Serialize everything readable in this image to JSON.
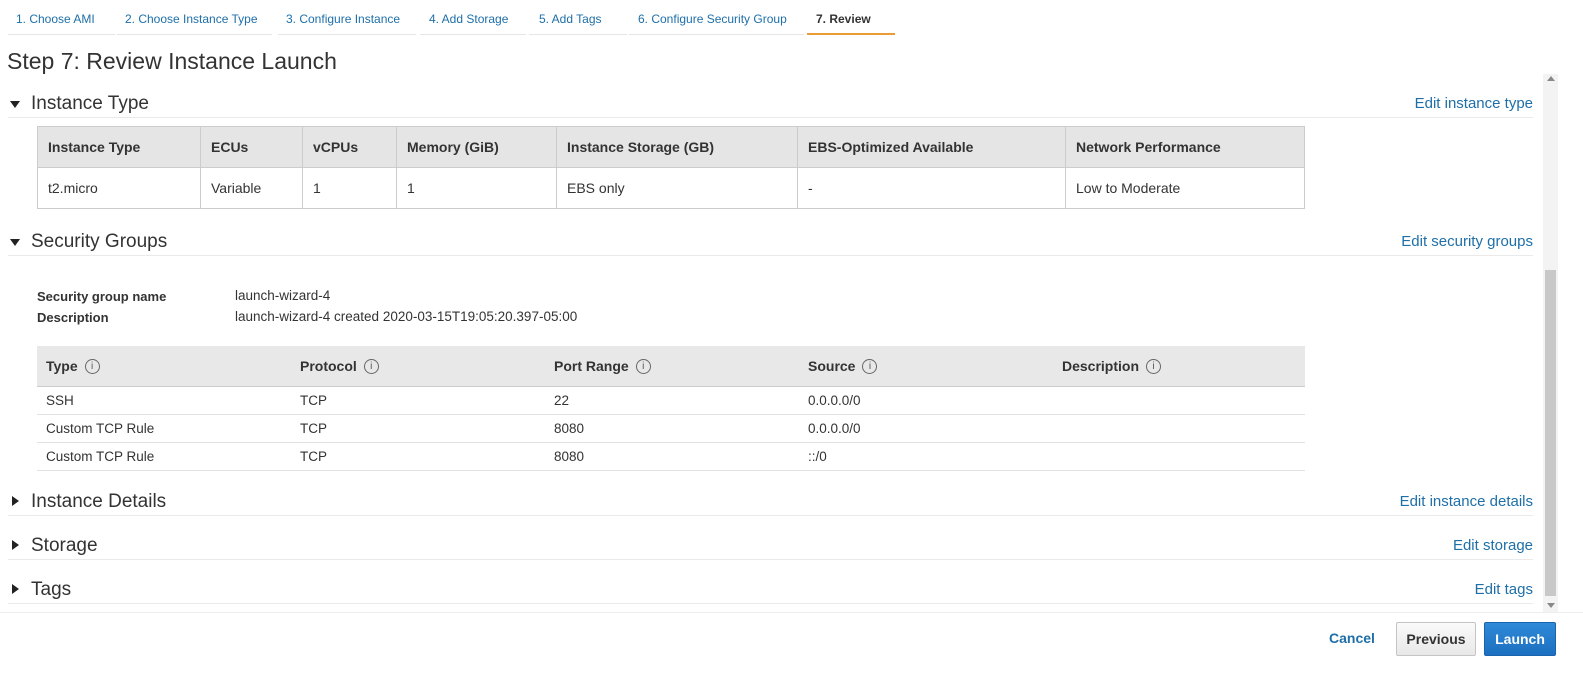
{
  "tabs": [
    {
      "label": "1. Choose AMI"
    },
    {
      "label": "2. Choose Instance Type"
    },
    {
      "label": "3. Configure Instance"
    },
    {
      "label": "4. Add Storage"
    },
    {
      "label": "5. Add Tags"
    },
    {
      "label": "6. Configure Security Group"
    },
    {
      "label": "7. Review",
      "active": true
    }
  ],
  "page_title": "Step 7: Review Instance Launch",
  "sections": {
    "instance_type": {
      "title": "Instance Type",
      "edit": "Edit instance type",
      "expanded": true
    },
    "security_groups": {
      "title": "Security Groups",
      "edit": "Edit security groups",
      "expanded": true
    },
    "instance_details": {
      "title": "Instance Details",
      "edit": "Edit instance details",
      "expanded": false
    },
    "storage": {
      "title": "Storage",
      "edit": "Edit storage",
      "expanded": false
    },
    "tags": {
      "title": "Tags",
      "edit": "Edit tags",
      "expanded": false
    }
  },
  "instance_table": {
    "headers": [
      "Instance Type",
      "ECUs",
      "vCPUs",
      "Memory (GiB)",
      "Instance Storage (GB)",
      "EBS-Optimized Available",
      "Network Performance"
    ],
    "row": [
      "t2.micro",
      "Variable",
      "1",
      "1",
      "EBS only",
      "-",
      "Low to Moderate"
    ]
  },
  "security_group": {
    "name_label": "Security group name",
    "name_value": "launch-wizard-4",
    "desc_label": "Description",
    "desc_value": "launch-wizard-4 created 2020-03-15T19:05:20.397-05:00"
  },
  "rules_table": {
    "headers": [
      "Type",
      "Protocol",
      "Port Range",
      "Source",
      "Description"
    ],
    "info_glyph": "i",
    "rows": [
      [
        "SSH",
        "TCP",
        "22",
        "0.0.0.0/0",
        ""
      ],
      [
        "Custom TCP Rule",
        "TCP",
        "8080",
        "0.0.0.0/0",
        ""
      ],
      [
        "Custom TCP Rule",
        "TCP",
        "8080",
        "::/0",
        ""
      ]
    ]
  },
  "footer": {
    "cancel": "Cancel",
    "previous": "Previous",
    "launch": "Launch"
  },
  "colors": {
    "link": "#1e6fa8",
    "active_tab_underline": "#ec9c36",
    "launch_button": "#1c6fc0"
  }
}
